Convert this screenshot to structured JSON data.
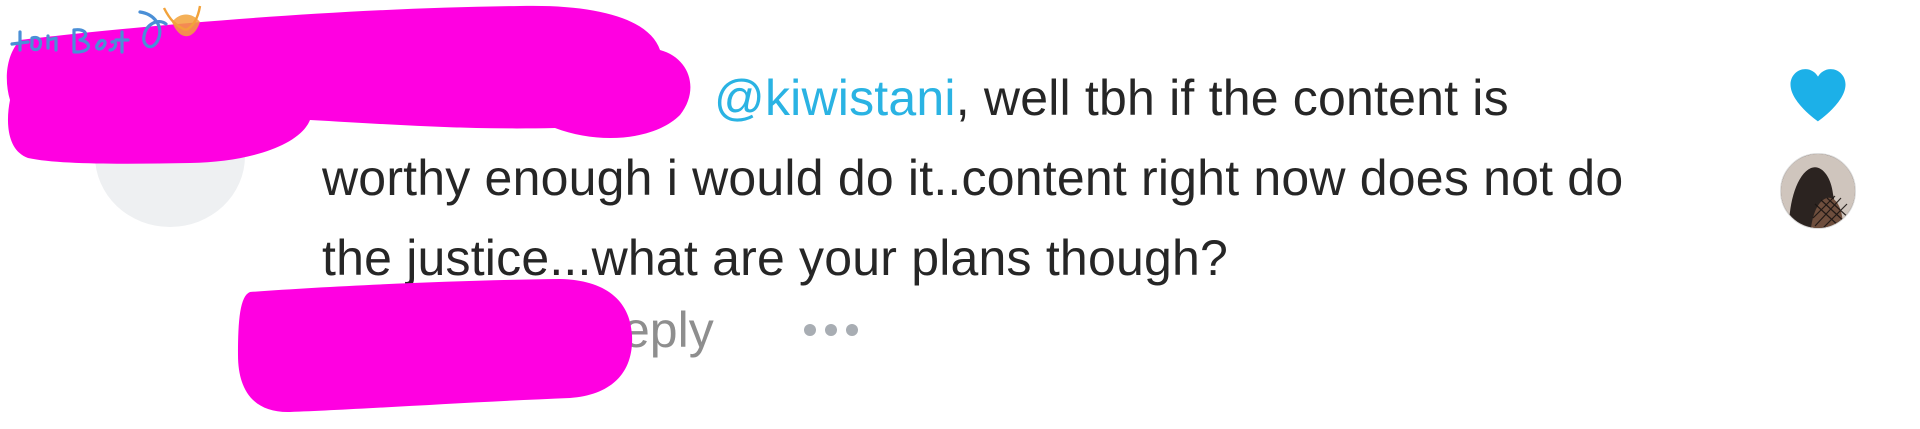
{
  "comment": {
    "mention": "@kiwistani",
    "text": ", well tbh if the content is worthy enough i would do it..content right now does not do the justice...what are your plans though?"
  },
  "actions": {
    "reply_label": "eply",
    "more_icon": "ellipsis-icon"
  },
  "like": {
    "icon": "heart-icon",
    "liked": true,
    "color": "#1cb0e8"
  },
  "liker_avatar": {
    "icon": "avatar"
  },
  "redaction_color": "#ff00e1",
  "watermark": {
    "text": "BestHot"
  }
}
